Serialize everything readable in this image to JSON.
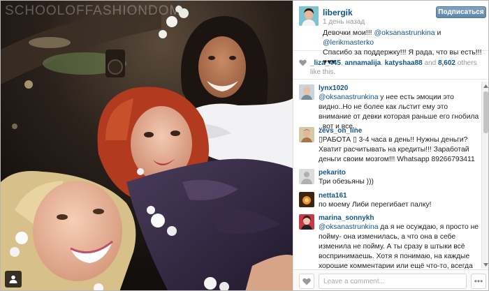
{
  "watermark": "SCHOOLOFFASHIONDOM",
  "post": {
    "author": "libergik",
    "time": "1 день назад",
    "follow_label": "Подписаться",
    "caption_text_1": "Девочки мои!!! ",
    "caption_mention_1": "@oksanastrunkina",
    "caption_and": " и ",
    "caption_mention_2": "@lerikmasterko",
    "caption_text_2": "Спасибо за поддержку!!! Я рада, что вы есть!!!",
    "caption_hearts": "♥♥♥"
  },
  "likes": {
    "likers": [
      "_liza_445",
      "annamalija",
      "katyshaa88"
    ],
    "and_label": " and ",
    "count": "8,602",
    "suffix": " others like this."
  },
  "comments": [
    {
      "user": "lynx1020",
      "mention": "@oksanastrunkina",
      "text": " у нее есть эмоции это видно..Но не более как льстит ему это внимание от девки которая раньше его гнобила ..вот и все.."
    },
    {
      "user": "zevs_on_line",
      "mention": "",
      "text": "▯РАБОТА ▯ 3-4 часа в день!! Нужны деньги? Хватит расчитывать на кредиты!!! Заработай деньги своим мозгом!!! Whatsapp 89266793411"
    },
    {
      "user": "pekarito",
      "mention": "",
      "text": "Три обезьяны )))"
    },
    {
      "user": "netta161",
      "mention": "",
      "text": "по моему Либи перегибает палку!"
    },
    {
      "user": "marina_sonnykh",
      "mention": "@oksanastrunkina",
      "text": " да я не осуждаю, я просто не пойму- она изменилась, а что она в себе изменила не пойму. А ты сразу в штыки всё воспринимаешь. Хотя я понимаю, на каждые хорошие комментарии или ещё что-то, всегда найдутся те люди, которые"
    }
  ],
  "compose": {
    "placeholder": "Leave a comment...",
    "more_label": "•••"
  },
  "colors": {
    "link": "#125688",
    "follow_button": "#6f97b6",
    "heart": "#999999"
  },
  "icons": [
    "user-tag-icon",
    "heart-icon",
    "scroll-up-arrow-icon",
    "scroll-down-arrow-icon",
    "more-icon"
  ]
}
